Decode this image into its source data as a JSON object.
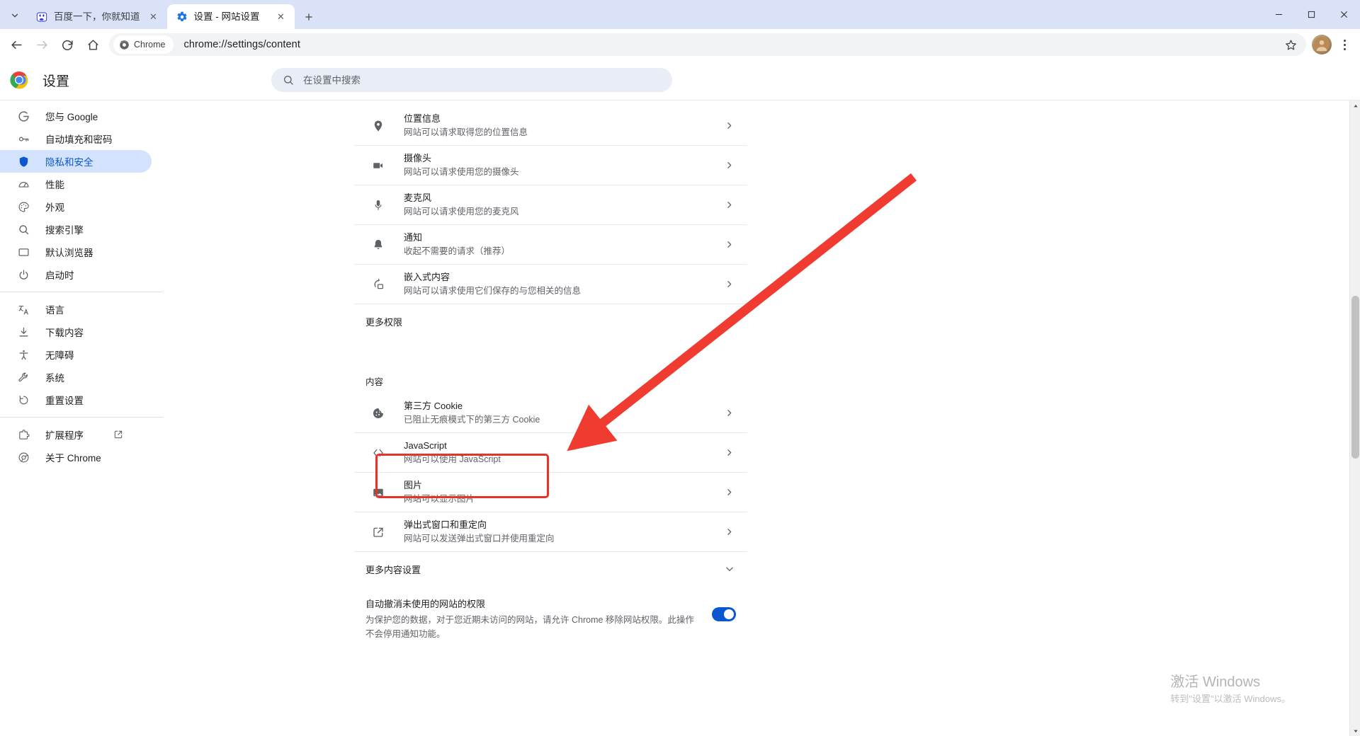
{
  "window": {
    "minimize_label": "—",
    "maximize_label": "□",
    "close_label": "✕"
  },
  "tabstrip": {
    "search_tabs_icon": "chevron-down-icon",
    "new_tab_label": "+",
    "tabs": [
      {
        "title": "百度一下，你就知道",
        "favicon": "baidu-icon",
        "active": false,
        "close_label": "✕"
      },
      {
        "title": "设置 - 网站设置",
        "favicon": "settings-gear-icon",
        "active": true,
        "close_label": "✕"
      }
    ]
  },
  "toolbar": {
    "back_icon": "back-arrow-icon",
    "forward_icon": "forward-arrow-icon",
    "reload_icon": "reload-icon",
    "home_icon": "home-icon",
    "chrome_chip_label": "Chrome",
    "url": "chrome://settings/content",
    "bookmark_icon": "star-icon",
    "profile_icon": "avatar",
    "menu_icon": "kebab-menu-icon"
  },
  "settings": {
    "logo": "chrome-logo",
    "title": "设置",
    "search": {
      "placeholder": "在设置中搜索",
      "value": "",
      "icon": "search-icon"
    }
  },
  "sidebar": {
    "groups": [
      {
        "items": [
          {
            "label": "您与 Google",
            "icon": "google-g-icon",
            "selected": false
          },
          {
            "label": "自动填充和密码",
            "icon": "key-icon",
            "selected": false
          },
          {
            "label": "隐私和安全",
            "icon": "shield-icon",
            "selected": true
          },
          {
            "label": "性能",
            "icon": "speedometer-icon",
            "selected": false
          },
          {
            "label": "外观",
            "icon": "palette-icon",
            "selected": false
          },
          {
            "label": "搜索引擎",
            "icon": "search-icon",
            "selected": false
          },
          {
            "label": "默认浏览器",
            "icon": "window-icon",
            "selected": false
          },
          {
            "label": "启动时",
            "icon": "power-icon",
            "selected": false
          }
        ]
      },
      {
        "items": [
          {
            "label": "语言",
            "icon": "translate-icon",
            "selected": false
          },
          {
            "label": "下载内容",
            "icon": "download-icon",
            "selected": false
          },
          {
            "label": "无障碍",
            "icon": "accessibility-icon",
            "selected": false
          },
          {
            "label": "系统",
            "icon": "wrench-icon",
            "selected": false
          },
          {
            "label": "重置设置",
            "icon": "restore-icon",
            "selected": false
          }
        ]
      },
      {
        "items": [
          {
            "label": "扩展程序",
            "icon": "extension-icon",
            "selected": false,
            "external": true
          },
          {
            "label": "关于 Chrome",
            "icon": "chrome-circle-icon",
            "selected": false
          }
        ]
      }
    ]
  },
  "content": {
    "permissions": [
      {
        "title": "位置信息",
        "sub": "网站可以请求取得您的位置信息",
        "icon": "location-pin-icon",
        "arrow": "chevron-right-icon"
      },
      {
        "title": "摄像头",
        "sub": "网站可以请求使用您的摄像头",
        "icon": "camera-icon",
        "arrow": "chevron-right-icon"
      },
      {
        "title": "麦克风",
        "sub": "网站可以请求使用您的麦克风",
        "icon": "microphone-icon",
        "arrow": "chevron-right-icon"
      },
      {
        "title": "通知",
        "sub": "收起不需要的请求（推荐）",
        "icon": "bell-icon",
        "arrow": "chevron-right-icon"
      },
      {
        "title": "嵌入式内容",
        "sub": "网站可以请求使用它们保存的与您相关的信息",
        "icon": "embedded-content-icon",
        "arrow": "chevron-right-icon"
      }
    ],
    "more_permissions": {
      "label": "更多权限",
      "icon": "chevron-down-icon"
    },
    "content_heading": "内容",
    "content_items": [
      {
        "title": "第三方 Cookie",
        "sub": "已阻止无痕模式下的第三方 Cookie",
        "icon": "cookie-icon",
        "arrow": "chevron-right-icon",
        "highlighted": false
      },
      {
        "title": "JavaScript",
        "sub": "网站可以使用 JavaScript",
        "icon": "code-brackets-icon",
        "arrow": "chevron-right-icon",
        "highlighted": false
      },
      {
        "title": "图片",
        "sub": "网站可以显示图片",
        "icon": "image-icon",
        "arrow": "chevron-right-icon",
        "highlighted": false
      },
      {
        "title": "弹出式窗口和重定向",
        "sub": "网站可以发送弹出式窗口并使用重定向",
        "icon": "popup-redirect-icon",
        "arrow": "chevron-right-icon",
        "highlighted": true
      }
    ],
    "more_content_settings": {
      "label": "更多内容设置",
      "icon": "chevron-down-icon"
    },
    "auto_revoke": {
      "title": "自动撤消未使用的网站的权限",
      "sub": "为保护您的数据，对于您近期未访问的网站，请允许 Chrome 移除网站权限。此操作不会停用通知功能。",
      "toggle_on": true
    }
  },
  "annotation": {
    "highlight_color": "#e63329",
    "arrow_color": "#ef3b30"
  },
  "watermark": {
    "title": "激活 Windows",
    "subtitle": "转到\"设置\"以激活 Windows。"
  }
}
